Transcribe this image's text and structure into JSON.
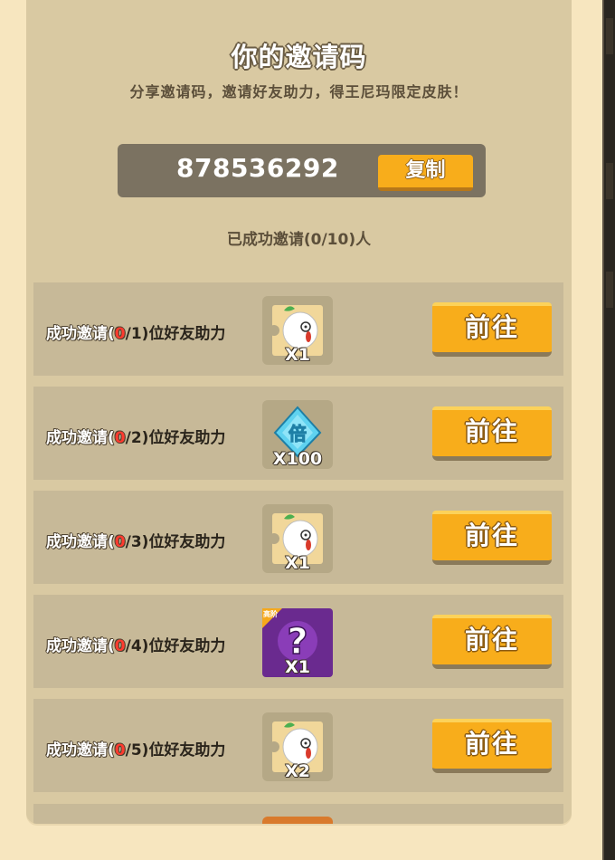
{
  "header": {
    "title": "你的邀请码",
    "subtitle": "分享邀请码，邀请好友助力，得王尼玛限定皮肤！"
  },
  "invite": {
    "code": "878536292",
    "copy_label": "复制",
    "progress_text": "已成功邀请(0/10)人"
  },
  "colors": {
    "panel": "#d9c9a2",
    "row": "#c7b998",
    "button": "#f8ad1b",
    "highlight_red": "#ff3b2f"
  },
  "rows": [
    {
      "prefix": "成功邀请(",
      "current": "0",
      "suffix": "/1)",
      "tail": "位好友助力",
      "reward_icon": "wangnima-skin-icon",
      "reward_count": "X1",
      "button": "前往"
    },
    {
      "prefix": "成功邀请(",
      "current": "0",
      "suffix": "/2)",
      "tail": "位好友助力",
      "reward_icon": "multiplier-diamond-icon",
      "reward_count": "X100",
      "button": "前往"
    },
    {
      "prefix": "成功邀请(",
      "current": "0",
      "suffix": "/3)",
      "tail": "位好友助力",
      "reward_icon": "wangnima-skin-icon",
      "reward_count": "X1",
      "button": "前往"
    },
    {
      "prefix": "成功邀请(",
      "current": "0",
      "suffix": "/4)",
      "tail": "位好友助力",
      "reward_icon": "mystery-box-icon",
      "reward_badge": "高阶",
      "reward_count": "X1",
      "button": "前往"
    },
    {
      "prefix": "成功邀请(",
      "current": "0",
      "suffix": "/5)",
      "tail": "位好友助力",
      "reward_icon": "wangnima-skin-icon",
      "reward_count": "X2",
      "button": "前往"
    }
  ]
}
